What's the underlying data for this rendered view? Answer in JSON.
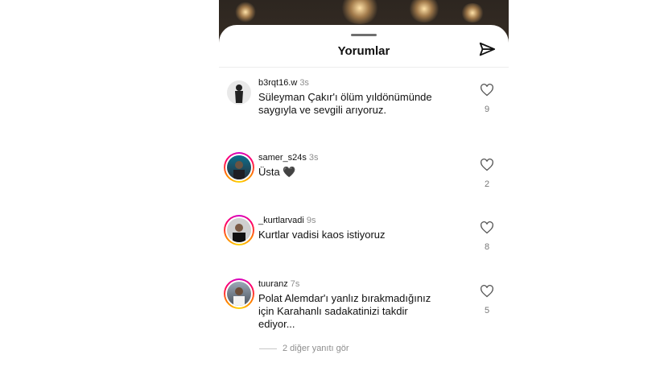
{
  "sheet": {
    "title": "Yorumlar"
  },
  "comments": [
    {
      "username": "b3rqt16.w",
      "time": "3s",
      "text": "Süleyman Çakır'ı ölüm yıldönümünde saygıyla ve sevgili arıyoruz.",
      "likes": "9"
    },
    {
      "username": "samer_s24s",
      "time": "3s",
      "text": "Üsta 🖤",
      "likes": "2"
    },
    {
      "username": "_kurtlarvadi",
      "time": "9s",
      "text": "Kurtlar vadisi kaos istiyoruz",
      "likes": "8"
    },
    {
      "username": "tuuranz",
      "time": "7s",
      "text": "Polat Alemdar'ı yanlız bırakmadığınız için Karahanlı sadakatinizi takdir ediyor...",
      "likes": "5"
    }
  ],
  "replies": {
    "label": "2 diğer yanıtı gör"
  },
  "icons": {
    "send": "send-icon",
    "like": "heart-outline-icon"
  }
}
